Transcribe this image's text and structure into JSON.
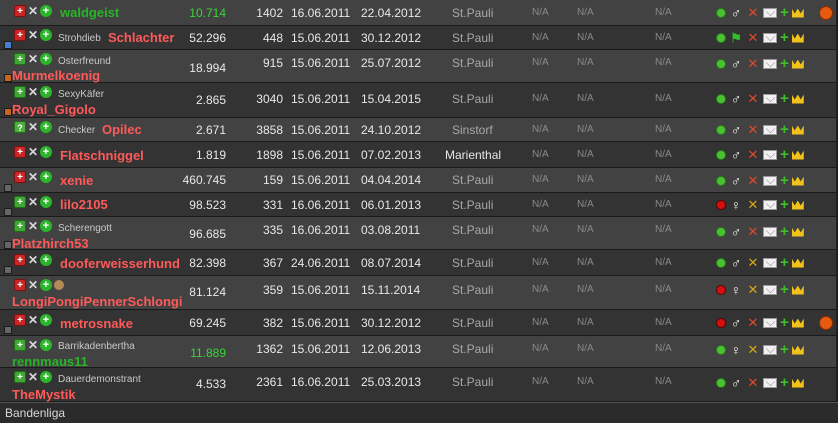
{
  "na_text": "N/A",
  "footer": {
    "label": "Bandenliga"
  },
  "rows": [
    {
      "title": "",
      "name": "waldgeist",
      "points": "10.714",
      "num": "1402",
      "date1": "16.06.2011",
      "date2": "22.04.2012",
      "gang": "St.Pauli"
    },
    {
      "title": "Strohdieb",
      "name": "Schlachter",
      "points": "52.296",
      "num": "448",
      "date1": "15.06.2011",
      "date2": "30.12.2012",
      "gang": "St.Pauli"
    },
    {
      "title": "Osterfreund",
      "name": "Murmelkoenig",
      "points": "18.994",
      "num": "915",
      "date1": "15.06.2011",
      "date2": "25.07.2012",
      "gang": "St.Pauli"
    },
    {
      "title": "SexyKäfer",
      "name": "Royal_Gigolo",
      "points": "2.865",
      "num": "3040",
      "date1": "15.06.2011",
      "date2": "15.04.2015",
      "gang": "St.Pauli"
    },
    {
      "title": "Checker",
      "name": "Opilec",
      "points": "2.671",
      "num": "3858",
      "date1": "15.06.2011",
      "date2": "24.10.2012",
      "gang": "Sinstorf"
    },
    {
      "title": "",
      "name": "Flatschniggel",
      "points": "1.819",
      "num": "1898",
      "date1": "15.06.2011",
      "date2": "07.02.2013",
      "gang": "Marienthal"
    },
    {
      "title": "",
      "name": "xenie",
      "points": "460.745",
      "num": "159",
      "date1": "15.06.2011",
      "date2": "04.04.2014",
      "gang": "St.Pauli"
    },
    {
      "title": "",
      "name": "lilo2105",
      "points": "98.523",
      "num": "331",
      "date1": "16.06.2011",
      "date2": "06.01.2013",
      "gang": "St.Pauli"
    },
    {
      "title": "Scherengott",
      "name": "Platzhirch53",
      "points": "96.685",
      "num": "335",
      "date1": "16.06.2011",
      "date2": "03.08.2011",
      "gang": "St.Pauli"
    },
    {
      "title": "",
      "name": "dooferweisserhund",
      "points": "82.398",
      "num": "367",
      "date1": "24.06.2011",
      "date2": "08.07.2014",
      "gang": "St.Pauli"
    },
    {
      "title": "",
      "name": "LongiPongiPennerSchlongi",
      "points": "81.124",
      "num": "359",
      "date1": "15.06.2011",
      "date2": "15.11.2014",
      "gang": "St.Pauli"
    },
    {
      "title": "",
      "name": "metrosnake",
      "points": "69.245",
      "num": "382",
      "date1": "15.06.2011",
      "date2": "30.12.2012",
      "gang": "St.Pauli"
    },
    {
      "title": "Barrikadenbertha",
      "name": "rennmaus11",
      "points": "11.889",
      "num": "1362",
      "date1": "15.06.2011",
      "date2": "12.06.2013",
      "gang": "St.Pauli"
    },
    {
      "title": "Dauerdemonstrant",
      "name": "TheMystik",
      "points": "4.533",
      "num": "2361",
      "date1": "16.06.2011",
      "date2": "25.03.2013",
      "gang": "St.Pauli"
    }
  ]
}
